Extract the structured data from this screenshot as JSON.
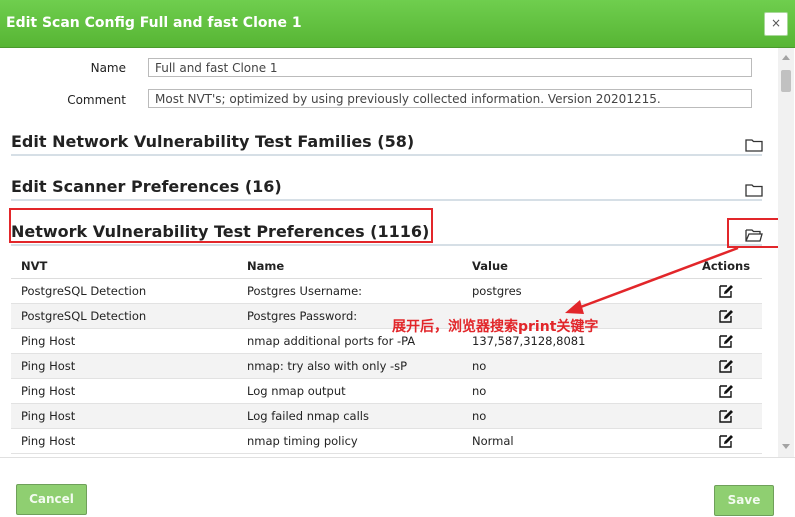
{
  "dialog": {
    "title": "Edit Scan Config Full and fast Clone 1",
    "close_symbol": "×"
  },
  "form": {
    "name_label": "Name",
    "name_value": "Full and fast Clone 1",
    "comment_label": "Comment",
    "comment_value": "Most NVT's; optimized by using previously collected information. Version 20201215."
  },
  "sections": {
    "families": "Edit Network Vulnerability Test Families (58)",
    "scanner": "Edit Scanner Preferences (16)",
    "nvt_prefs": "Network Vulnerability Test Preferences (1116)"
  },
  "table": {
    "headers": [
      "NVT",
      "Name",
      "Value",
      "Actions"
    ],
    "rows": [
      [
        "PostgreSQL Detection",
        "Postgres Username:",
        "postgres"
      ],
      [
        "PostgreSQL Detection",
        "Postgres Password:",
        ""
      ],
      [
        "Ping Host",
        "nmap additional ports for -PA",
        "137,587,3128,8081"
      ],
      [
        "Ping Host",
        "nmap: try also with only -sP",
        "no"
      ],
      [
        "Ping Host",
        "Log nmap output",
        "no"
      ],
      [
        "Ping Host",
        "Log failed nmap calls",
        "no"
      ],
      [
        "Ping Host",
        "nmap timing policy",
        "Normal"
      ]
    ]
  },
  "annotation": "展开后，浏览器搜索print关键字",
  "footer": {
    "cancel_label": "Cancel",
    "save_label": "Save"
  },
  "colors": {
    "titlebar": "#5cbf39",
    "annotation_red": "#e2262a",
    "button_green": "#8fcf71"
  },
  "icons": {
    "section_toggle": "folder-icon",
    "row_action": "edit-icon",
    "close": "close-icon"
  }
}
